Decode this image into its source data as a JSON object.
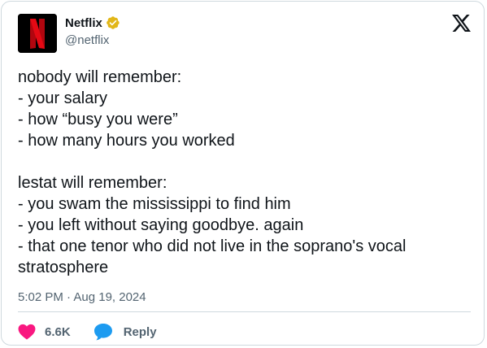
{
  "author": {
    "display_name": "Netflix",
    "handle": "@netflix",
    "avatar_icon": "netflix-n-logo",
    "verified_icon": "verified-badge-icon",
    "verified_color": "#E2B719",
    "brand_color": "#E50914"
  },
  "platform": {
    "logo_icon": "x-logo-icon"
  },
  "tweet": {
    "text": "nobody will remember:\n- your salary\n- how “busy you were”\n- how many hours you worked\n\nlestat will remember:\n- you swam the mississippi to find him\n- you left without saying goodbye. again\n- that one tenor who did not live in the soprano's vocal stratosphere",
    "timestamp": "5:02 PM · Aug 19, 2024"
  },
  "actions": {
    "like_count": "6.6K",
    "like_icon": "heart-icon",
    "like_color": "#F91880",
    "reply_label": "Reply",
    "reply_icon": "speech-bubble-icon",
    "reply_color": "#1D9BF0"
  }
}
